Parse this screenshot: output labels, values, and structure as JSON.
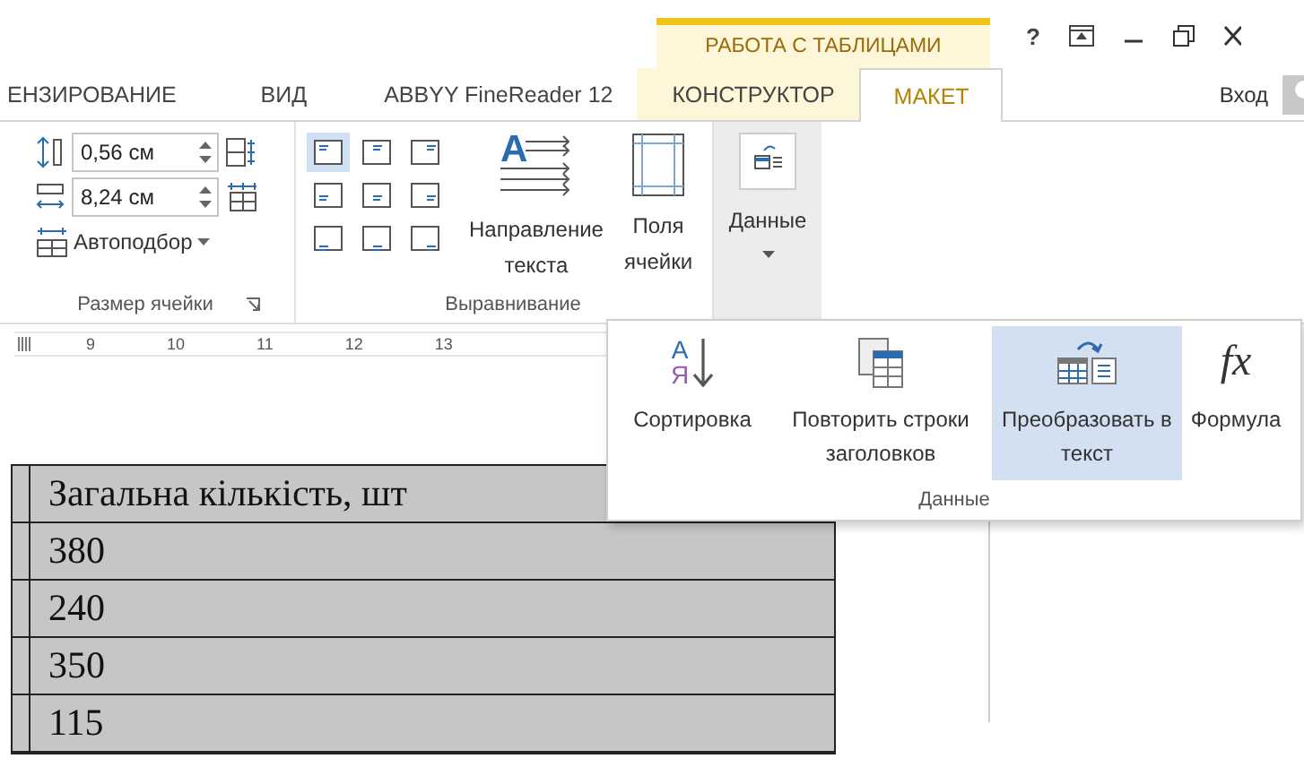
{
  "context_tab_group": {
    "label": "РАБОТА С ТАБЛИЦАМИ"
  },
  "help": "?",
  "tabs": [
    {
      "label": "ЕНЗИРОВАНИЕ",
      "selected": false,
      "contextual": false
    },
    {
      "label": "ВИД",
      "selected": false,
      "contextual": false
    },
    {
      "label": "ABBYY FineReader 12",
      "selected": false,
      "contextual": false
    },
    {
      "label": "КОНСТРУКТОР",
      "selected": false,
      "contextual": true
    },
    {
      "label": "МАКЕТ",
      "selected": true,
      "contextual": true
    }
  ],
  "sign_in": "Вход",
  "cell_size": {
    "height": "0,56 см",
    "width": "8,24 см",
    "autofit": "Автоподбор",
    "label": "Размер ячейки"
  },
  "alignment": {
    "buttons": [
      {
        "selected": true
      },
      {
        "selected": false
      },
      {
        "selected": false
      },
      {
        "selected": false
      },
      {
        "selected": false
      },
      {
        "selected": false
      },
      {
        "selected": false
      },
      {
        "selected": false
      },
      {
        "selected": false
      }
    ],
    "text_direction_glyph": "A",
    "text_direction": "Направление текста",
    "cell_margins": "Поля ячейки",
    "label": "Выравнивание"
  },
  "data_button": {
    "label": "Данные",
    "selected": true
  },
  "ruler": {
    "numbers": [
      "9",
      "10",
      "11",
      "12",
      "13"
    ]
  },
  "data_popup": {
    "label": "Данные",
    "items": [
      {
        "kind": "sort",
        "glyphs": [
          "A",
          "Я"
        ],
        "label": "Сортировка",
        "selected": false
      },
      {
        "kind": "repeat",
        "label": "Повторить строки заголовков",
        "selected": false
      },
      {
        "kind": "convert",
        "label": "Преобразовать в текст",
        "selected": true
      },
      {
        "kind": "formula",
        "glyphs": [
          "fx"
        ],
        "label": "Формула",
        "selected": false
      }
    ]
  },
  "table": {
    "rows": [
      "Загальна кількість, шт",
      "380",
      "240",
      "350",
      "115"
    ]
  }
}
